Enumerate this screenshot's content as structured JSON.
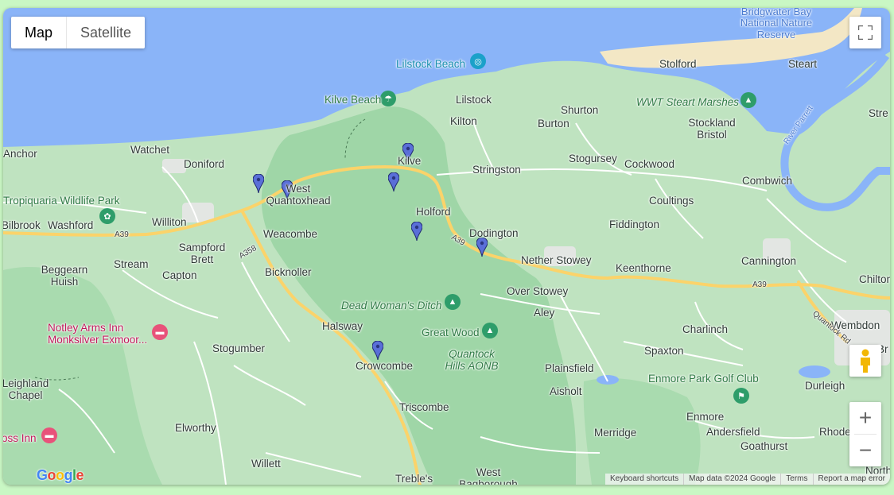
{
  "map_type": {
    "map": "Map",
    "satellite": "Satellite"
  },
  "labels": {
    "bridgwater_bay": "Bridgwater Bay National Nature Reserve",
    "lilstock_beach": "Lilstock Beach",
    "kilve_beach": "Kilve Beach",
    "stolford": "Stolford",
    "steart": "Steart",
    "lilstock": "Lilstock",
    "shurton": "Shurton",
    "wwt_steart": "WWT Steart Marshes",
    "kilton": "Kilton",
    "burton": "Burton",
    "stockland_bristol": "Stockland Bristol",
    "river_parrett": "River Parrett",
    "stre": "Stre",
    "anchor": "Anchor",
    "watchet": "Watchet",
    "doniford": "Doniford",
    "kilve": "Kilve",
    "stringston": "Stringston",
    "stogursey": "Stogursey",
    "cockwood": "Cockwood",
    "combwich": "Combwich",
    "west_quantoxhead": "West Quantoxhead",
    "tropiquaria": "Tropiquaria Wildlife Park",
    "holford": "Holford",
    "coultings": "Coultings",
    "bilbrook": "Bilbrook",
    "washford": "Washford",
    "williton": "Williton",
    "weacombe": "Weacombe",
    "dodington": "Dodington",
    "fiddington": "Fiddington",
    "sampford_brett": "Sampford Brett",
    "nether_stowey": "Nether Stowey",
    "cannington": "Cannington",
    "beggearn_huish": "Beggearn Huish",
    "stream": "Stream",
    "capton": "Capton",
    "bicknoller": "Bicknoller",
    "keenthorne": "Keenthorne",
    "chilton": "Chilton",
    "over_stowey": "Over Stowey",
    "dead_womans_ditch": "Dead Woman's Ditch",
    "aley": "Aley",
    "notley_arms": "Notley Arms Inn Monksilver Exmoor...",
    "halsway": "Halsway",
    "great_wood": "Great Wood",
    "charlinch": "Charlinch",
    "wembdon": "Wembdon",
    "stogumber": "Stogumber",
    "quantock_hills": "Quantock Hills AONB",
    "spaxton": "Spaxton",
    "crowcombe": "Crowcombe",
    "plainsfield": "Plainsfield",
    "enmore_golf": "Enmore Park Golf Club",
    "durleigh": "Durleigh",
    "leighland_chapel": "Leighland Chapel",
    "aisholt": "Aisholt",
    "triscombe": "Triscombe",
    "enmore": "Enmore",
    "elworthy": "Elworthy",
    "merridge": "Merridge",
    "andersfield": "Andersfield",
    "rhode": "Rhode",
    "goathurst": "Goathurst",
    "oss_inn": "oss Inn",
    "willett": "Willett",
    "west_bagborough": "West Bagborough",
    "trebles": "Treble's",
    "north": "North",
    "a39_a": "A39",
    "a39_b": "A39",
    "a39_c": "A39",
    "a358": "A358",
    "quantock_rd": "Quantock Rd",
    "br": "Br"
  },
  "footer": {
    "shortcuts": "Keyboard shortcuts",
    "map_data": "Map data ©2024 Google",
    "terms": "Terms",
    "report": "Report a map error"
  },
  "logo": "Google",
  "controls": {
    "zoom_in": "+",
    "zoom_out": "−"
  },
  "markers_count": 7,
  "colors": {
    "water": "#8ab4f8",
    "land": "#bfe3c0",
    "park": "#9ed6a6",
    "road_major": "#fbd36a",
    "marker": "#5a6fd8",
    "beach": "#f2e6c7"
  }
}
